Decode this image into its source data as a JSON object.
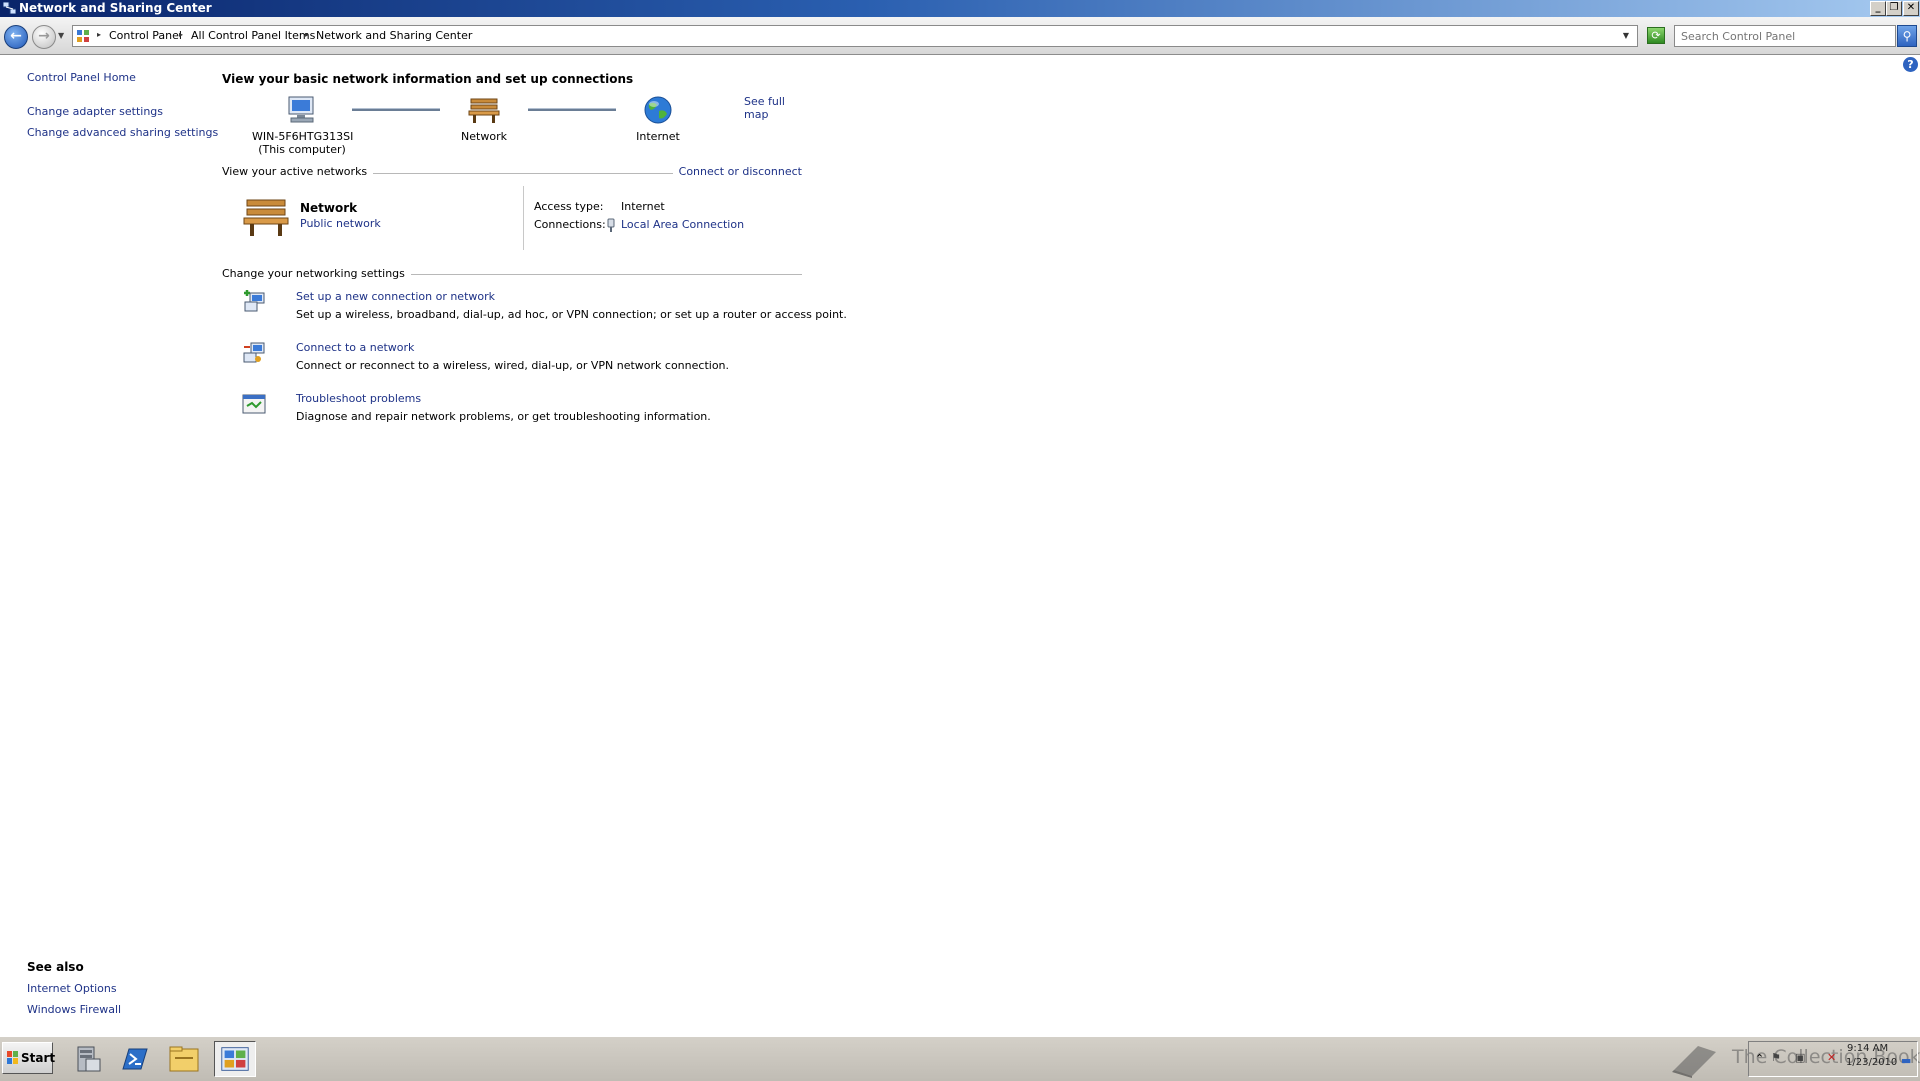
{
  "window": {
    "title": "Network and Sharing Center"
  },
  "navigation": {
    "breadcrumb": [
      "Control Panel",
      "All Control Panel Items",
      "Network and Sharing Center"
    ],
    "search_placeholder": "Search Control Panel"
  },
  "left_pane": {
    "links": [
      "Control Panel Home",
      "Change adapter settings",
      "Change advanced sharing settings"
    ],
    "see_also_title": "See also",
    "see_also_links": [
      "Internet Options",
      "Windows Firewall"
    ]
  },
  "main": {
    "heading": "View your basic network information and set up connections",
    "see_full_map": "See full map",
    "map": {
      "computer_name": "WIN-5F6HTG313SI",
      "computer_sub": "(This computer)",
      "network_label": "Network",
      "internet_label": "Internet"
    },
    "active_networks": {
      "section_title": "View your active networks",
      "connect_link": "Connect or disconnect",
      "network_name": "Network",
      "network_type": "Public network",
      "access_type_label": "Access type:",
      "access_type_value": "Internet",
      "connections_label": "Connections:",
      "connections_value": "Local Area Connection"
    },
    "settings": {
      "section_title": "Change your networking settings",
      "tasks": [
        {
          "title": "Set up a new connection or network",
          "description": "Set up a wireless, broadband, dial-up, ad hoc, or VPN connection; or set up a router or access point."
        },
        {
          "title": "Connect to a network",
          "description": "Connect or reconnect to a wireless, wired, dial-up, or VPN network connection."
        },
        {
          "title": "Troubleshoot problems",
          "description": "Diagnose and repair network problems, or get troubleshooting information."
        }
      ]
    }
  },
  "taskbar": {
    "start_label": "Start",
    "clock_time": "9:14 AM",
    "clock_date": "1/23/2010",
    "watermark": "The Collection Book",
    "pinned_icons": [
      "server-manager-icon",
      "powershell-icon",
      "explorer-icon",
      "control-panel-icon"
    ]
  },
  "colors": {
    "link": "#1e3287",
    "titlebar_start": "#0a246a",
    "titlebar_end": "#a6caf0"
  }
}
